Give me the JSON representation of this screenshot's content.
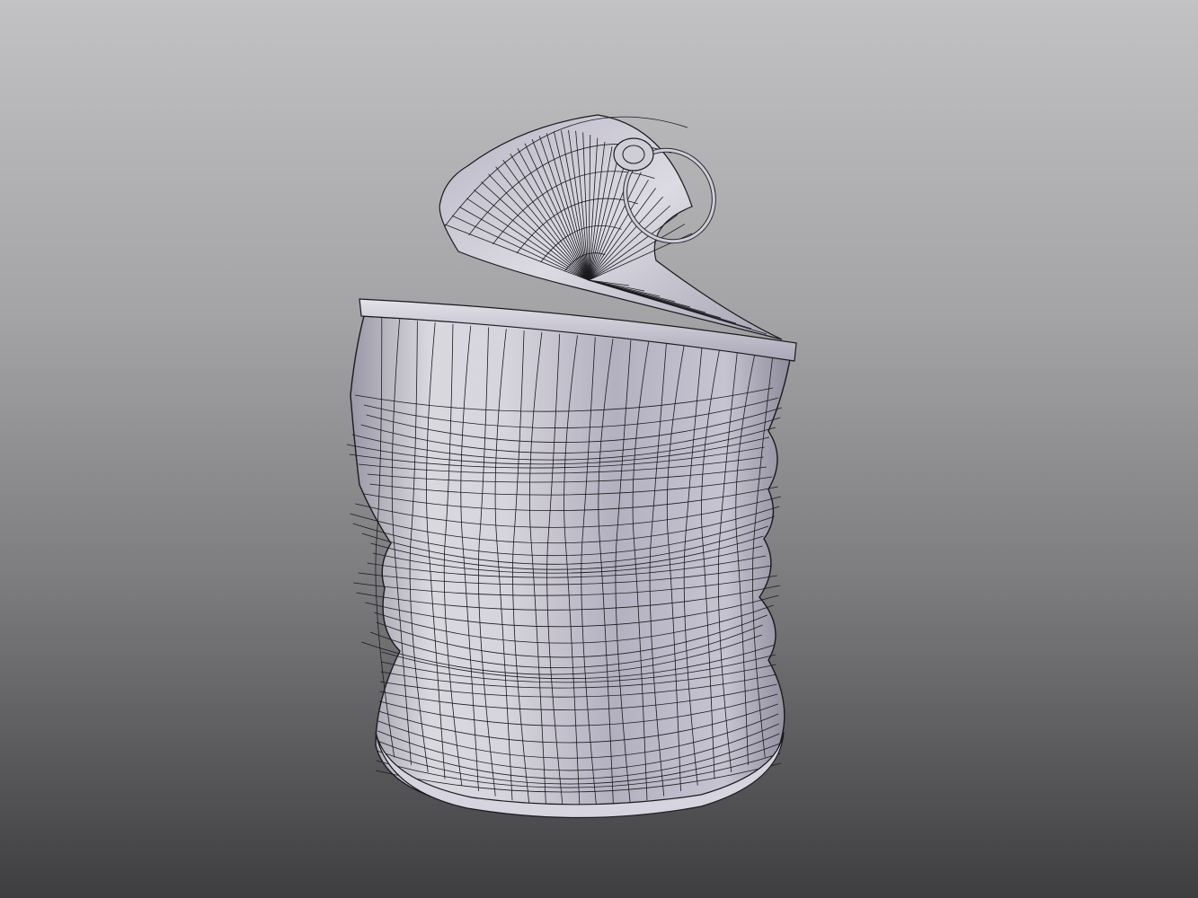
{
  "viewport": {
    "background_top": "#c2c1c3",
    "background_bottom": "#3e3d40"
  },
  "model": {
    "subject": "crushed-can-wireframe",
    "surface_color": "#c9c6d2",
    "edge_color": "#1a1a1e",
    "rendering": "shaded-with-wireframe"
  }
}
